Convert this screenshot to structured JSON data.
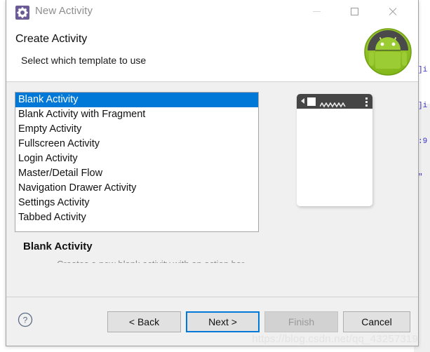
{
  "window": {
    "title": "New Activity",
    "icon": "gear-icon",
    "controls": {
      "minimize": "minimize-icon",
      "maximize": "maximize-icon",
      "close": "close-icon"
    }
  },
  "header": {
    "title": "Create Activity",
    "subtitle": "Select which template to use",
    "logo": "android-robot-logo"
  },
  "templates": {
    "items": [
      "Blank Activity",
      "Blank Activity with Fragment",
      "Empty Activity",
      "Fullscreen Activity",
      "Login Activity",
      "Master/Detail Flow",
      "Navigation Drawer Activity",
      "Settings Activity",
      "Tabbed Activity"
    ],
    "selected_index": 0,
    "selection_color": "#0078d7"
  },
  "description": {
    "title": "Blank Activity",
    "clipped_text": "Creates a new blank activity with an action bar."
  },
  "preview": {
    "name": "phone-preview",
    "appbar": {
      "back": "chevron-left-icon",
      "app_icon": "app-square-icon",
      "title_placeholder": "squiggle-placeholder",
      "overflow": "overflow-menu-icon"
    },
    "appbar_color": "#454545"
  },
  "footer": {
    "help": "help-icon",
    "buttons": [
      {
        "label": "< Back",
        "state": "enabled"
      },
      {
        "label": "Next >",
        "state": "focused"
      },
      {
        "label": "Finish",
        "state": "disabled"
      },
      {
        "label": "Cancel",
        "state": "enabled"
      }
    ],
    "watermark": "https://blog.csdn.net/qq_43257319"
  },
  "backdrop": {
    "code_lines": [
      "]i",
      "]i",
      ":9",
      "\""
    ]
  }
}
